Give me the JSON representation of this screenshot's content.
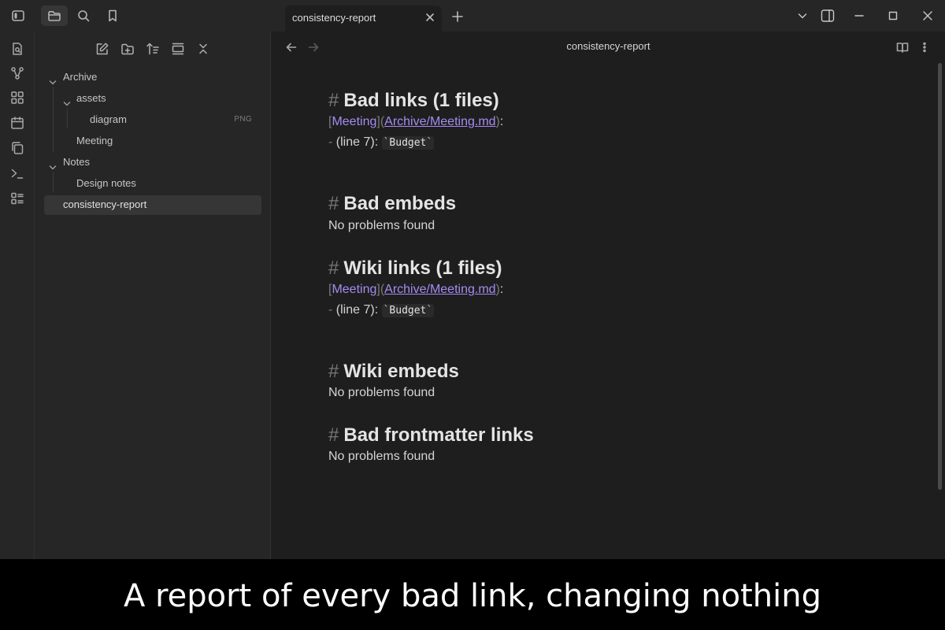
{
  "titlebar": {
    "tab_title": "consistency-report",
    "icons": [
      "sidebar-toggle-icon",
      "folder-icon",
      "search-icon",
      "bookmark-icon"
    ],
    "window_controls": [
      "chevron-down-icon",
      "right-sidebar-icon",
      "minimize-icon",
      "maximize-icon",
      "close-icon"
    ]
  },
  "ribbon": {
    "icons": [
      "quick-switcher-icon",
      "graph-view-icon",
      "canvas-icon",
      "daily-note-icon",
      "templates-icon",
      "command-palette-icon",
      "bases-icon"
    ]
  },
  "sidebar": {
    "nav_actions": [
      "new-note-icon",
      "new-folder-icon",
      "sort-icon",
      "collapse-icon",
      "expand-collapse-icon"
    ],
    "tree": {
      "archive": "Archive",
      "assets": "assets",
      "diagram": "diagram",
      "diagram_badge": "PNG",
      "meeting": "Meeting",
      "notes": "Notes",
      "design_notes": "Design notes",
      "report": "consistency-report"
    }
  },
  "main": {
    "view_title": "consistency-report",
    "sections": {
      "bad_links": {
        "heading": "Bad links (1 files)",
        "link_text": "Meeting",
        "link_url": "Archive/Meeting.md",
        "item_prefix": "(line 7):",
        "item_code": "Budget"
      },
      "bad_embeds": {
        "heading": "Bad embeds",
        "status": "No problems found"
      },
      "wiki_links": {
        "heading": "Wiki links (1 files)",
        "link_text": "Meeting",
        "link_url": "Archive/Meeting.md",
        "item_prefix": "(line 7):",
        "item_code": "Budget"
      },
      "wiki_embeds": {
        "heading": "Wiki embeds",
        "status": "No problems found"
      },
      "bad_frontmatter": {
        "heading": "Bad frontmatter links",
        "status": "No problems found"
      }
    }
  },
  "caption": "A report of every bad link, changing nothing",
  "colors": {
    "link": "#a58bf2",
    "background": "#1e1e1e",
    "sidebar": "#262626"
  }
}
